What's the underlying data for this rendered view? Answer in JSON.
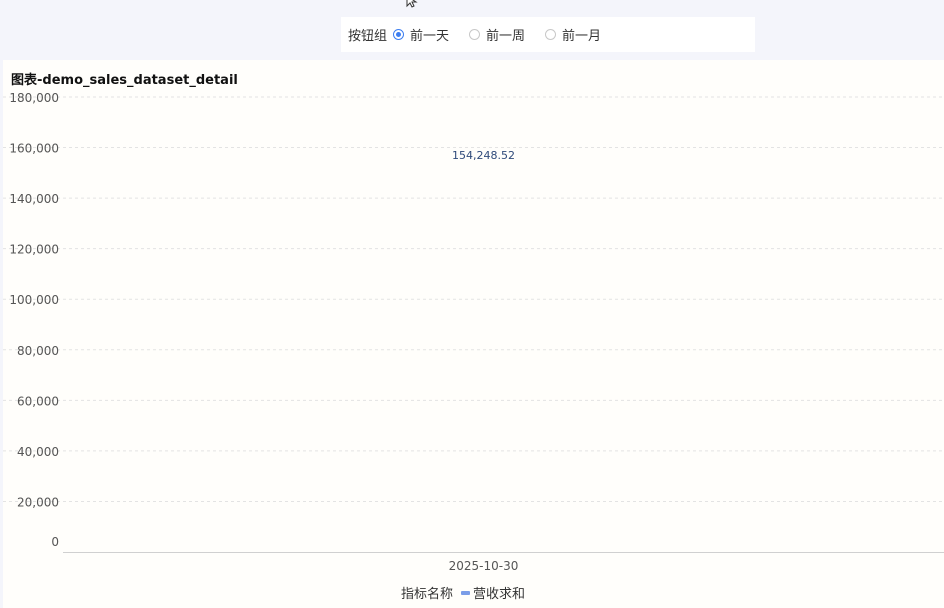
{
  "filter": {
    "label": "按钮组",
    "options": [
      {
        "label": "前一天",
        "checked": true
      },
      {
        "label": "前一周",
        "checked": false
      },
      {
        "label": "前一月",
        "checked": false
      }
    ]
  },
  "chart_title": "图表-demo_sales_dataset_detail",
  "legend": {
    "title": "指标名称",
    "series_label": "营收求和",
    "color": "#7b9de8"
  },
  "chart_data": {
    "type": "bar",
    "categories": [
      "2025-10-30"
    ],
    "series": [
      {
        "name": "营收求和",
        "values": [
          154248.52
        ],
        "labels": [
          "154,248.52"
        ]
      }
    ],
    "ylim": [
      0,
      180000
    ],
    "yticks": [
      0,
      20000,
      40000,
      60000,
      80000,
      100000,
      120000,
      140000,
      160000,
      180000
    ],
    "ytick_labels": [
      "0",
      "20,000",
      "40,000",
      "60,000",
      "80,000",
      "100,000",
      "120,000",
      "140,000",
      "160,000",
      "180,000"
    ],
    "grid": true,
    "legend_position": "bottom"
  }
}
